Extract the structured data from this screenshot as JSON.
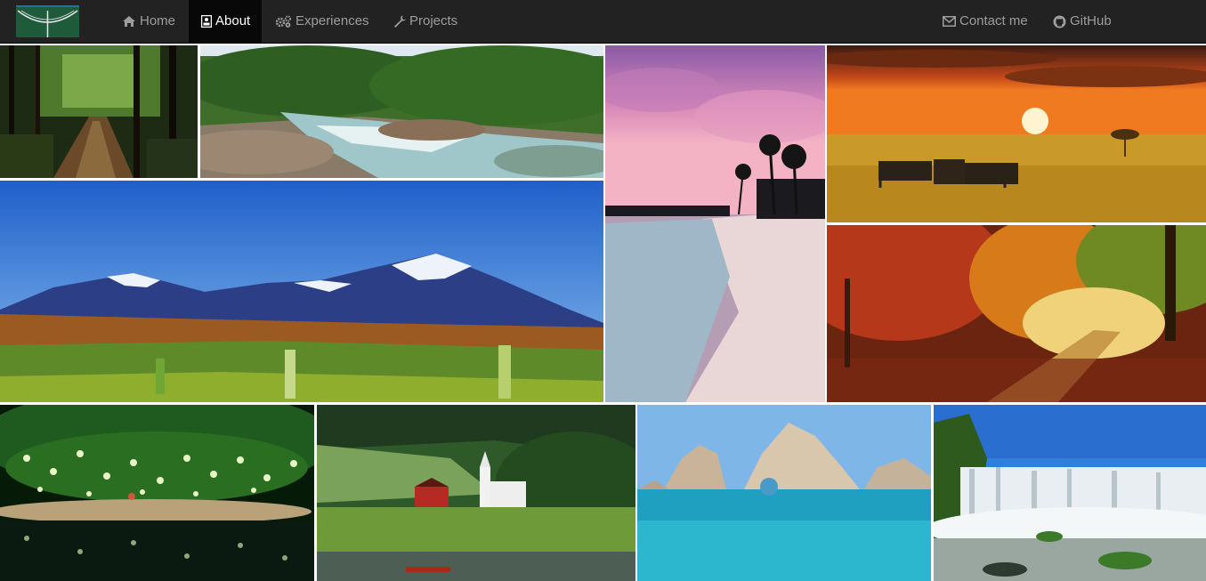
{
  "nav": {
    "brand_name": "brand-logo",
    "items": [
      {
        "label": "Home",
        "icon": "home-icon"
      },
      {
        "label": "About",
        "icon": "id-card-icon"
      },
      {
        "label": "Experiences",
        "icon": "cogs-icon"
      },
      {
        "label": "Projects",
        "icon": "wrench-icon"
      }
    ],
    "right_items": [
      {
        "label": "Contact me",
        "icon": "envelope-icon"
      },
      {
        "label": "GitHub",
        "icon": "github-icon"
      }
    ],
    "active_item": "About"
  },
  "colors": {
    "navbar_bg": "#222222",
    "nav_text": "#9d9d9d",
    "nav_active_bg": "#080808",
    "nav_active_text": "#ffffff"
  },
  "gallery": {
    "photos": [
      {
        "subject": "forest trail"
      },
      {
        "subject": "rocky river"
      },
      {
        "subject": "pink sky beach with palm trees"
      },
      {
        "subject": "savanna sunset with zebras"
      },
      {
        "subject": "snowy mountains over fields"
      },
      {
        "subject": "autumn forest path"
      },
      {
        "subject": "glowing wisteria tunnel over water"
      },
      {
        "subject": "fjord village with church"
      },
      {
        "subject": "sea arch rocks in turquoise water"
      },
      {
        "subject": "large waterfall"
      }
    ]
  }
}
